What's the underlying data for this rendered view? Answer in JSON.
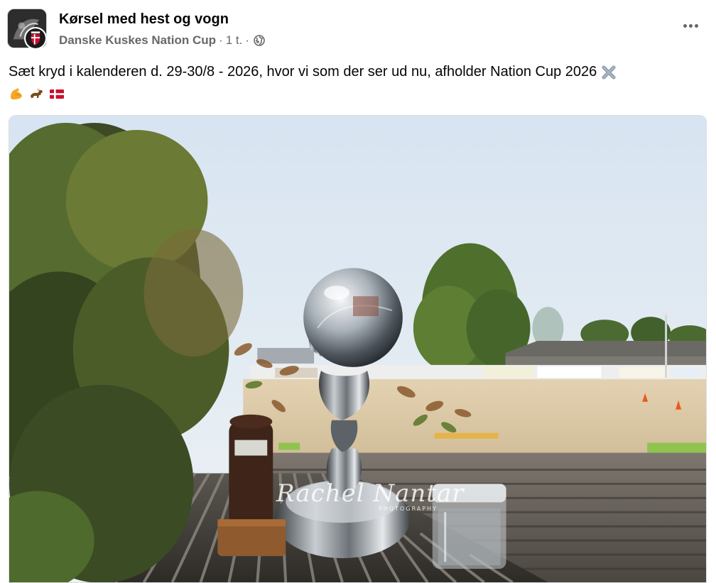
{
  "post": {
    "group_name": "Kørsel med hest og vogn",
    "author": "Danske Kuskes Nation Cup",
    "separator": "·",
    "time": "1 t.",
    "audience_icon": "globe-icon",
    "more_icon": "more-options-icon",
    "caption_line1": "Sæt kryd i kalenderen d. 29-30/8 - 2026, hvor vi som der ser ud nu,  afholder Nation Cup 2026",
    "caption_emojis_line1": [
      "cross-mark-emoji"
    ],
    "caption_emojis_line2": [
      "flexed-biceps-emoji",
      "horse-racing-emoji",
      "denmark-flag-emoji"
    ]
  },
  "photo": {
    "watermark_text": "Rachel Nantar",
    "watermark_sub": "PHOTOGRAPHY"
  },
  "colors": {
    "meta_text": "#65676b",
    "primary_text": "#050505",
    "sky": "#dfe9f3",
    "arena_sand": "#d8c6a6"
  }
}
